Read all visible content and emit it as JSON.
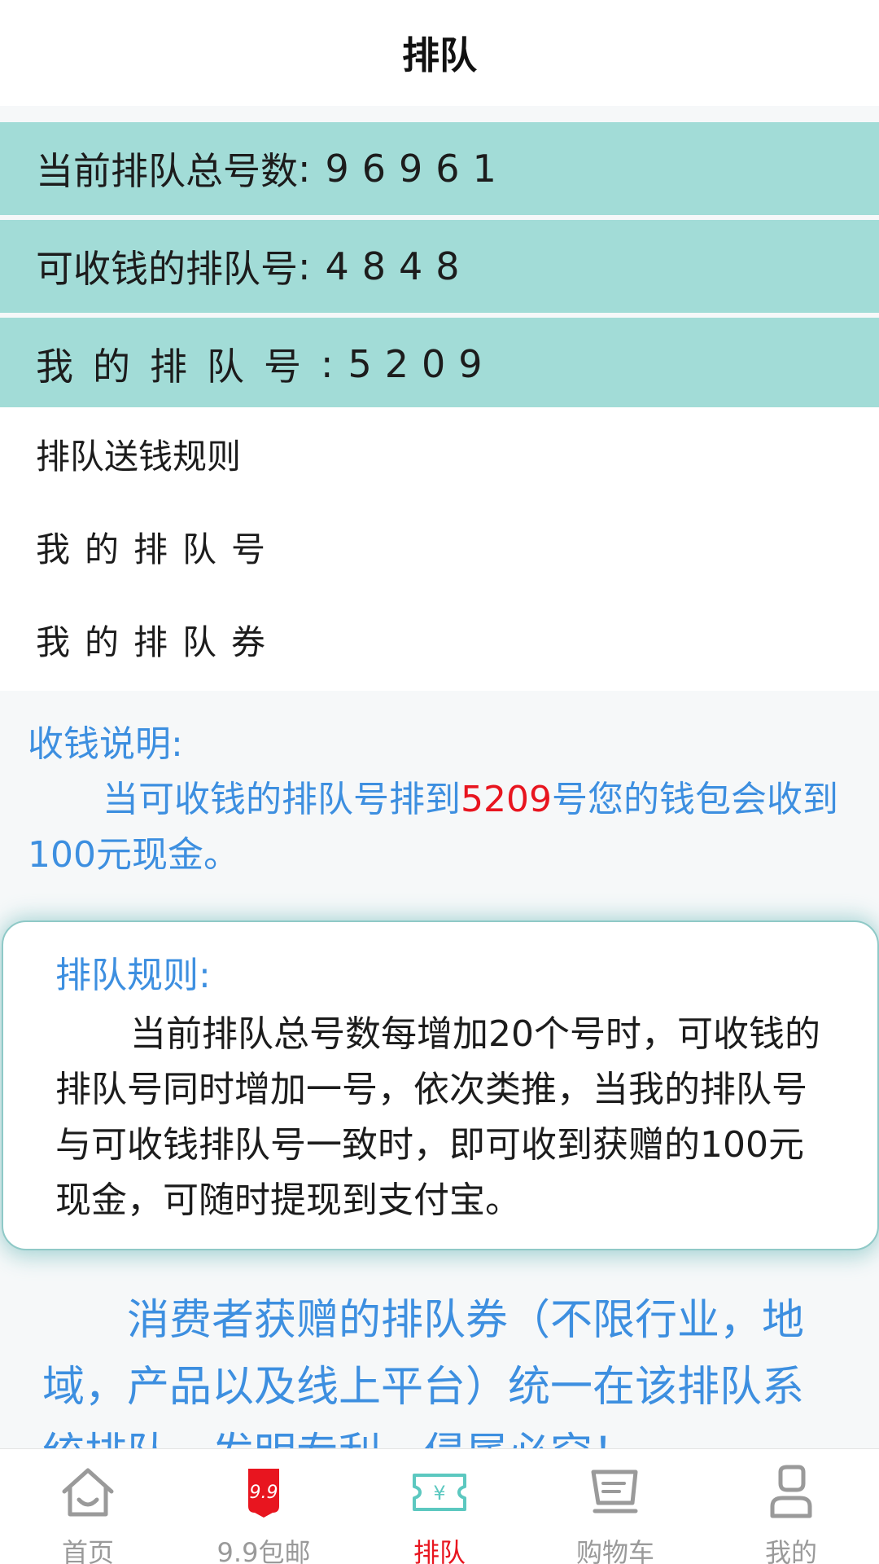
{
  "header": {
    "title": "排队"
  },
  "stats": [
    {
      "label": "当前排队总号数",
      "colon": ":",
      "value": "96961"
    },
    {
      "label": "可收钱的排队号",
      "colon": ":",
      "value": "4848"
    },
    {
      "label": "我的排队号",
      "colon": ":",
      "value": "5209"
    }
  ],
  "menu": [
    {
      "label": "排队送钱规则"
    },
    {
      "label": "我的排队号"
    },
    {
      "label": "我的排队券"
    }
  ],
  "info": {
    "title": "收钱说明:",
    "pre": "当可收钱的排队号排到",
    "highlight": "5209",
    "post": "号您的钱包会收到100元现金。"
  },
  "rules": {
    "title": "排队规则:",
    "body": "当前排队总号数每增加20个号时，可收钱的排队号同时增加一号，依次类推，当我的排队号与可收钱排队号一致时，即可收到获赠的100元现金，可随时提现到支付宝。"
  },
  "promo": {
    "text": "消费者获赠的排队券（不限行业，地域，产品以及线上平台）统一在该排队系统排队，发明专利，侵属必究！"
  },
  "tabbar": {
    "items": [
      {
        "label": "首页",
        "icon": "home-icon"
      },
      {
        "label": "9.9包邮",
        "icon": "nine-nine-badge-icon",
        "badge": "9.9"
      },
      {
        "label": "排队",
        "icon": "ticket-icon",
        "active": true
      },
      {
        "label": "购物车",
        "icon": "cart-icon"
      },
      {
        "label": "我的",
        "icon": "user-icon"
      }
    ],
    "colors": {
      "active": "#e8151f",
      "inactive": "#9a9a9a",
      "accent": "#5cc8c0"
    }
  }
}
